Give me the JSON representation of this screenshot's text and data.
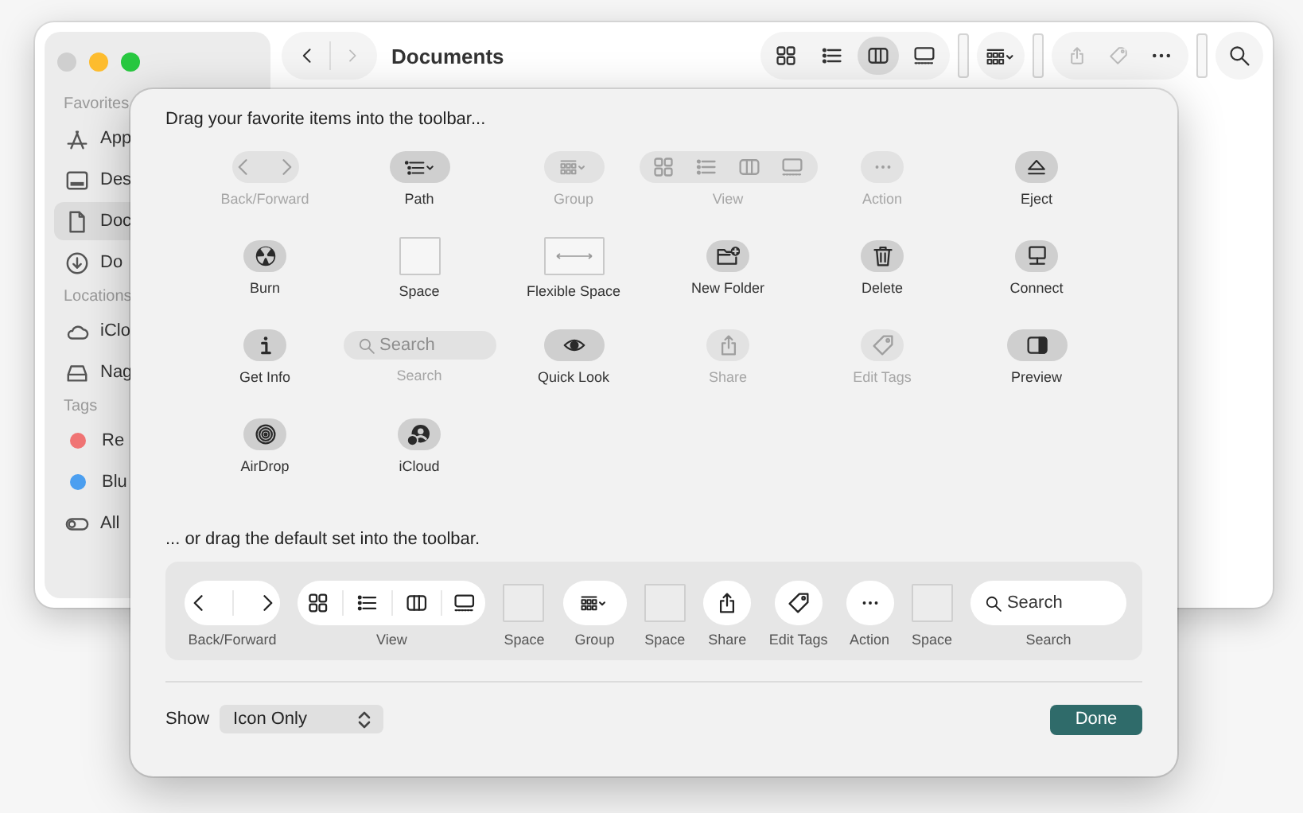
{
  "window": {
    "title": "Documents",
    "sidebar": [
      {
        "heading": "Favorites",
        "items": [
          {
            "label": "App",
            "kind": "apps",
            "selected": false
          },
          {
            "label": "Des",
            "kind": "desktop",
            "selected": false
          },
          {
            "label": "Doc",
            "kind": "document",
            "selected": true
          },
          {
            "label": "Do",
            "kind": "download",
            "selected": false
          }
        ]
      },
      {
        "heading": "Locations",
        "items": [
          {
            "label": "iClo",
            "kind": "cloud",
            "selected": false
          },
          {
            "label": "Nag",
            "kind": "drive",
            "selected": false
          }
        ]
      },
      {
        "heading": "Tags",
        "items": [
          {
            "label": "Re",
            "kind": "tag",
            "color": "#f07474",
            "selected": false
          },
          {
            "label": "Blu",
            "kind": "tag",
            "color": "#4c9ff0",
            "selected": false
          },
          {
            "label": "All",
            "kind": "all-tags",
            "selected": false
          }
        ]
      }
    ],
    "toolbar": {
      "view_buttons": [
        {
          "kind": "grid",
          "selected": false
        },
        {
          "kind": "list",
          "selected": false
        },
        {
          "kind": "columns",
          "selected": true
        },
        {
          "kind": "gallery",
          "selected": false
        }
      ]
    }
  },
  "sheet": {
    "palette_heading": "Drag your favorite items into the toolbar...",
    "palette": [
      {
        "label": "Back/Forward",
        "kind": "back-forward",
        "dimmed": true
      },
      {
        "label": "Path",
        "kind": "path",
        "dimmed": false
      },
      {
        "label": "Group",
        "kind": "group",
        "dimmed": true
      },
      {
        "label": "View",
        "kind": "view",
        "dimmed": true
      },
      {
        "label": "Action",
        "kind": "action",
        "dimmed": true
      },
      {
        "label": "Eject",
        "kind": "eject",
        "dimmed": false
      },
      {
        "label": "Burn",
        "kind": "burn",
        "dimmed": false
      },
      {
        "label": "Space",
        "kind": "space",
        "dimmed": false
      },
      {
        "label": "Flexible Space",
        "kind": "flexible-space",
        "dimmed": false
      },
      {
        "label": "New Folder",
        "kind": "new-folder",
        "dimmed": false
      },
      {
        "label": "Delete",
        "kind": "delete",
        "dimmed": false
      },
      {
        "label": "Connect",
        "kind": "connect",
        "dimmed": false
      },
      {
        "label": "Get Info",
        "kind": "info",
        "dimmed": false
      },
      {
        "label": "Search",
        "kind": "search",
        "dimmed": true,
        "placeholder": "Search"
      },
      {
        "label": "Quick Look",
        "kind": "quick-look",
        "dimmed": false
      },
      {
        "label": "Share",
        "kind": "share",
        "dimmed": true
      },
      {
        "label": "Edit Tags",
        "kind": "edit-tags",
        "dimmed": true
      },
      {
        "label": "Preview",
        "kind": "preview",
        "dimmed": false
      },
      {
        "label": "AirDrop",
        "kind": "airdrop",
        "dimmed": false
      },
      {
        "label": "iCloud",
        "kind": "icloud",
        "dimmed": false
      }
    ],
    "default_heading": "... or drag the default set into the toolbar.",
    "default_set": [
      {
        "label": "Back/Forward",
        "kind": "back-forward"
      },
      {
        "label": "View",
        "kind": "view"
      },
      {
        "label": "Space",
        "kind": "space"
      },
      {
        "label": "Group",
        "kind": "group"
      },
      {
        "label": "Space",
        "kind": "space"
      },
      {
        "label": "Share",
        "kind": "share"
      },
      {
        "label": "Edit Tags",
        "kind": "edit-tags"
      },
      {
        "label": "Action",
        "kind": "action"
      },
      {
        "label": "Space",
        "kind": "space"
      },
      {
        "label": "Search",
        "kind": "search",
        "placeholder": "Search"
      }
    ],
    "show_label": "Show",
    "show_value": "Icon Only",
    "done": "Done"
  }
}
